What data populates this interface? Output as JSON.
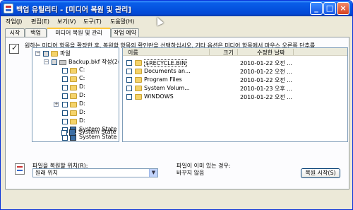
{
  "window": {
    "title": "백업 유틸리티 - [미디어 복원 및 관리]",
    "controls": [
      "minimize",
      "maximize",
      "close"
    ]
  },
  "menu": [
    "작업(J)",
    "편집(E)",
    "보기(V)",
    "도구(T)",
    "도움말(H)"
  ],
  "tabs": [
    {
      "label": "시작",
      "active": false
    },
    {
      "label": "백업",
      "active": false
    },
    {
      "label": "미디어 복원 및 관리",
      "active": true
    },
    {
      "label": "작업 예약",
      "active": false
    }
  ],
  "instruction": "원하는 미디어 항목을 확장한 후, 복원할 항목의 확인란을 선택하십시오. 기타 옵션은 미디어 항목에서 마우스 오른쪽 단추를",
  "tree": {
    "root": "파일",
    "backup": "Backup.bkf 작성(2(",
    "drives": [
      "C:",
      "C:",
      "D:",
      "D:",
      "D:",
      "D:",
      "D:"
    ],
    "system_items": [
      "System State",
      "System State",
      "System State"
    ]
  },
  "list": {
    "headers": {
      "name": "이름",
      "size": "크기",
      "modified": "수정한 날짜"
    },
    "rows": [
      {
        "name": "$RECYCLE.BIN",
        "date": "2010-01-22 오전 ..."
      },
      {
        "name": "Documents an...",
        "date": "2010-01-22 오전 ..."
      },
      {
        "name": "Program Files",
        "date": "2010-01-22 오전 ..."
      },
      {
        "name": "System Volum...",
        "date": "2010-01-23 오후 ..."
      },
      {
        "name": "WINDOWS",
        "date": "2010-01-22 오전 ..."
      }
    ]
  },
  "restore": {
    "label": "파일을 복원할 위치(R):",
    "location": "원래 위치",
    "exists_label": "파일이 이미 있는 경우:",
    "exists_value": "바꾸지 않음",
    "start_button": "복원 시작(S)"
  },
  "icons": {
    "app": "backup-app-icon",
    "folder": "folder-icon",
    "drive": "drive-icon",
    "system_state": "system-state-icon",
    "restore": "restore-document-icon"
  }
}
